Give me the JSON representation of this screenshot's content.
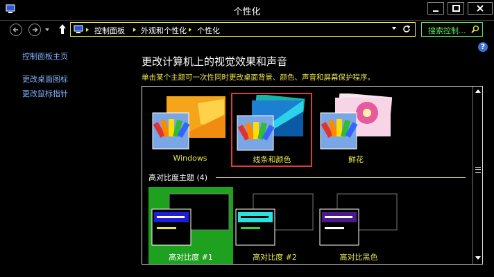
{
  "window": {
    "title": "个性化"
  },
  "address": {
    "crumbs": [
      "控制面板",
      "外观和个性化",
      "个性化"
    ],
    "search_placeholder": "搜索控制..."
  },
  "help_label": "?",
  "sidebar": {
    "items": [
      {
        "label": "控制面板主页"
      },
      {
        "label": "更改桌面图标"
      },
      {
        "label": "更改鼠标指针"
      }
    ]
  },
  "main": {
    "heading": "更改计算机上的视觉效果和声音",
    "subheading": "单击某个主题可一次性同时更改桌面背景、颜色、声音和屏幕保护程序。",
    "themes": [
      {
        "label": "Windows"
      },
      {
        "label": "线条和颜色",
        "selected": true
      },
      {
        "label": "鲜花"
      }
    ],
    "high_contrast": {
      "section_title": "高对比度主题 (4)",
      "themes": [
        {
          "label": "高对比度 #1",
          "selected": true
        },
        {
          "label": "高对比度 #2"
        },
        {
          "label": "高对比黑色"
        }
      ]
    }
  },
  "colors": {
    "accent_yellow": "#e8e64b",
    "link_blue": "#7fb2ff",
    "selected_green": "#1ea11e",
    "selection_red": "#e03b3b"
  }
}
